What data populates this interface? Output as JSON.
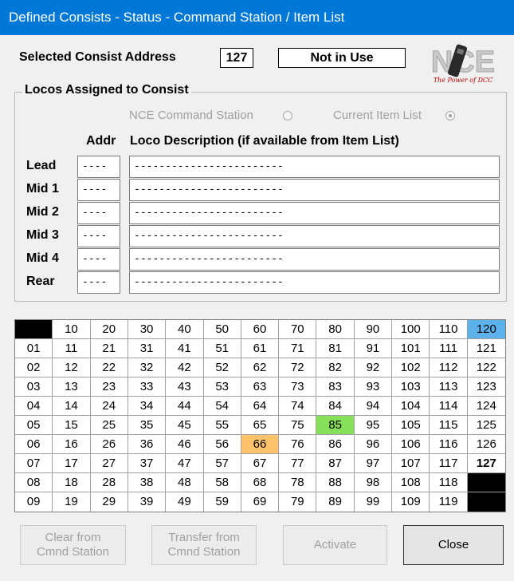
{
  "window": {
    "title": "Defined Consists - Status - Command Station / Item List"
  },
  "header": {
    "selected_label": "Selected Consist Address",
    "address_value": "127",
    "status_value": "Not in Use",
    "logo_text": "NCE",
    "logo_tagline": "The Power of DCC"
  },
  "group": {
    "title": "Locos Assigned to Consist",
    "source_options": [
      {
        "label": "NCE Command Station",
        "selected": false
      },
      {
        "label": "Current Item List",
        "selected": true
      }
    ],
    "addr_header": "Addr",
    "desc_header": "Loco Description (if available from Item List)",
    "rows": [
      {
        "label": "Lead",
        "addr": "----",
        "desc": "------------------------"
      },
      {
        "label": "Mid 1",
        "addr": "----",
        "desc": "------------------------"
      },
      {
        "label": "Mid 2",
        "addr": "----",
        "desc": "------------------------"
      },
      {
        "label": "Mid 3",
        "addr": "----",
        "desc": "------------------------"
      },
      {
        "label": "Mid 4",
        "addr": "----",
        "desc": "------------------------"
      },
      {
        "label": "Rear",
        "addr": "----",
        "desc": "------------------------"
      }
    ]
  },
  "grid": {
    "rows": [
      [
        "",
        "10",
        "20",
        "30",
        "40",
        "50",
        "60",
        "70",
        "80",
        "90",
        "100",
        "110",
        "120"
      ],
      [
        "01",
        "11",
        "21",
        "31",
        "41",
        "51",
        "61",
        "71",
        "81",
        "91",
        "101",
        "111",
        "121"
      ],
      [
        "02",
        "12",
        "22",
        "32",
        "42",
        "52",
        "62",
        "72",
        "82",
        "92",
        "102",
        "112",
        "122"
      ],
      [
        "03",
        "13",
        "23",
        "33",
        "43",
        "53",
        "63",
        "73",
        "83",
        "93",
        "103",
        "113",
        "123"
      ],
      [
        "04",
        "14",
        "24",
        "34",
        "44",
        "54",
        "64",
        "74",
        "84",
        "94",
        "104",
        "114",
        "124"
      ],
      [
        "05",
        "15",
        "25",
        "35",
        "45",
        "55",
        "65",
        "75",
        "85",
        "95",
        "105",
        "115",
        "125"
      ],
      [
        "06",
        "16",
        "26",
        "36",
        "46",
        "56",
        "66",
        "76",
        "86",
        "96",
        "106",
        "116",
        "126"
      ],
      [
        "07",
        "17",
        "27",
        "37",
        "47",
        "57",
        "67",
        "77",
        "87",
        "97",
        "107",
        "117",
        "127"
      ],
      [
        "08",
        "18",
        "28",
        "38",
        "48",
        "58",
        "68",
        "78",
        "88",
        "98",
        "108",
        "118",
        ""
      ],
      [
        "09",
        "19",
        "29",
        "39",
        "49",
        "59",
        "69",
        "79",
        "89",
        "99",
        "109",
        "119",
        ""
      ]
    ],
    "highlights": {
      "black": [
        "0-0",
        "8-12",
        "9-12"
      ],
      "blue": [
        "0-12"
      ],
      "green": [
        "5-8"
      ],
      "orange": [
        "6-6"
      ],
      "bold": [
        "7-12"
      ]
    },
    "colors": {
      "black": "#000000",
      "blue": "#5db2ec",
      "green": "#86e05a",
      "orange": "#ffc36b"
    }
  },
  "buttons": {
    "clear": "Clear from\nCmnd Station",
    "transfer": "Transfer from\nCmnd Station",
    "activate": "Activate",
    "close": "Close"
  }
}
